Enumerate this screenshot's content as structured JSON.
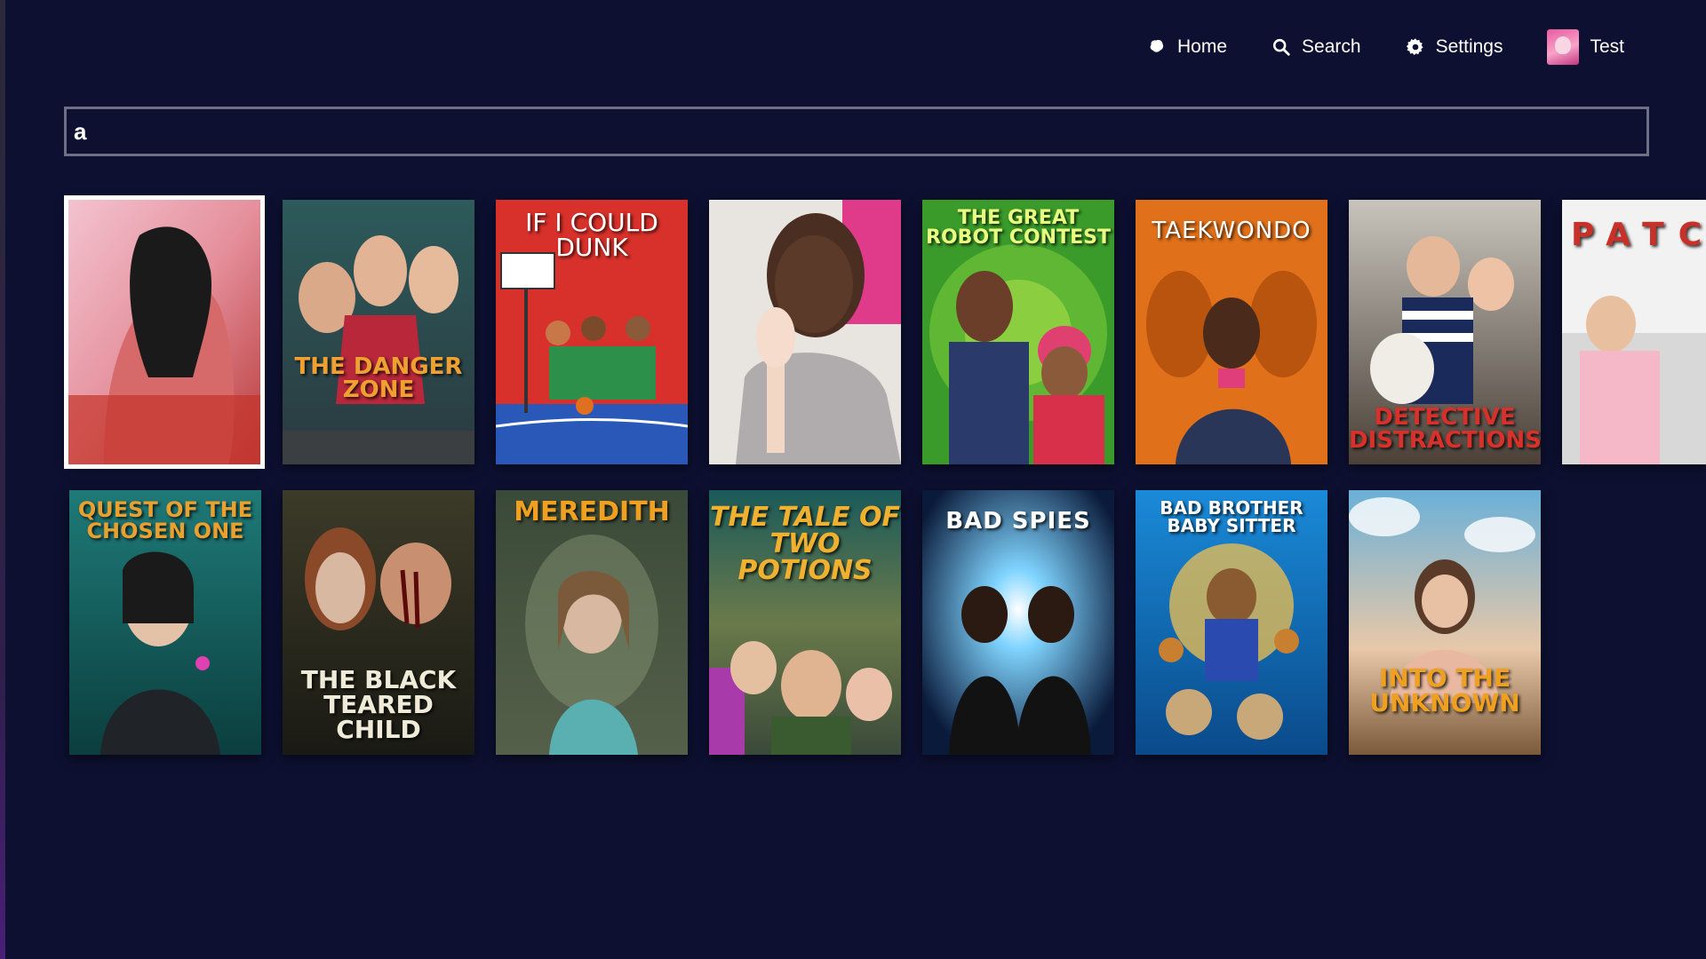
{
  "nav": {
    "home_label": "Home",
    "search_label": "Search",
    "settings_label": "Settings",
    "user_label": "Test"
  },
  "search": {
    "value": "a"
  },
  "colors": {
    "background": "#0d1030",
    "search_border": "#6d6f86",
    "selected_outline": "#ffffff"
  },
  "results": [
    {
      "title": "",
      "selected": true
    },
    {
      "title": "THE DANGER ZONE"
    },
    {
      "title": "IF I COULD DUNK"
    },
    {
      "title": ""
    },
    {
      "title": "THE GREAT ROBOT CONTEST"
    },
    {
      "title": "TAEKWONDO"
    },
    {
      "title": "DETECTIVE DISTRACTIONS"
    },
    {
      "title": "PATC"
    },
    {
      "title": "QUEST OF THE CHOSEN ONE"
    },
    {
      "title": "THE BLACK TEARED CHILD"
    },
    {
      "title": "MEREDITH"
    },
    {
      "title": "THE TALE OF TWO POTIONS"
    },
    {
      "title": "BAD SPIES"
    },
    {
      "title": "BAD BROTHER BABY SITTER"
    },
    {
      "title": "INTO THE UNKNOWN"
    }
  ]
}
